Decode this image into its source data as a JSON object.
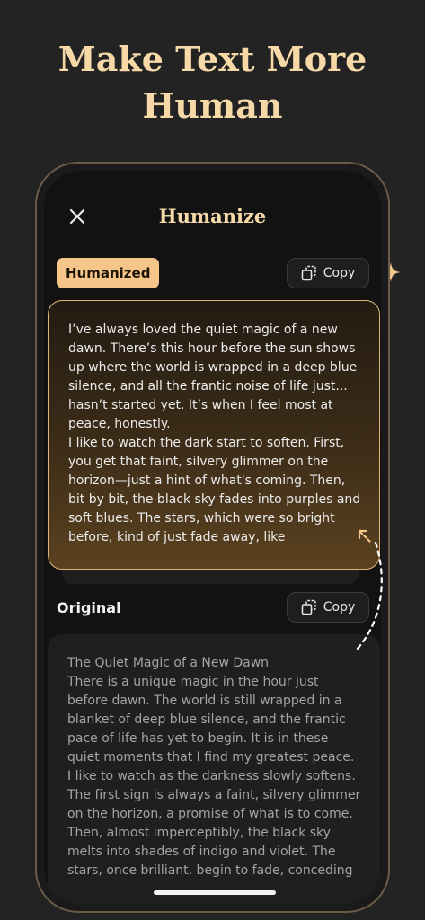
{
  "headline": {
    "line1": "Make Text More",
    "line2": "Human"
  },
  "screen": {
    "title": "Humanize",
    "close_icon": "close-icon"
  },
  "humanized": {
    "badge": "Humanized",
    "copy_label": "Copy",
    "paragraphs": [
      "I’ve always loved the quiet magic of a new dawn. There’s this hour before the sun shows up where the world is wrapped in a deep blue silence, and all the frantic noise of life just... hasn’t started yet. It’s when I feel most at peace, honestly.",
      "I like to watch the dark start to soften. First, you get that faint, silvery glimmer on the horizon—just a hint of what's coming. Then, bit by bit, the black sky fades into purples and soft blues. The stars, which were so bright before, kind of just fade away, like"
    ]
  },
  "original": {
    "label": "Original",
    "copy_label": "Copy",
    "paragraphs": [
      "The Quiet Magic of a New Dawn",
      "There is a unique magic in the hour just before dawn. The world is still wrapped in a blanket of deep blue silence, and the frantic pace of life has yet to begin. It is in these quiet moments that I find my greatest peace.",
      "I like to watch as the darkness slowly softens. The first sign is always a faint, silvery glimmer on the horizon, a promise of what is to come. Then, almost imperceptibly, the black sky melts into shades of indigo and violet. The stars, once brilliant, begin to fade, conceding"
    ]
  },
  "colors": {
    "accent": "#f5c58a",
    "headline": "#f7d9a8",
    "background": "#232323"
  }
}
